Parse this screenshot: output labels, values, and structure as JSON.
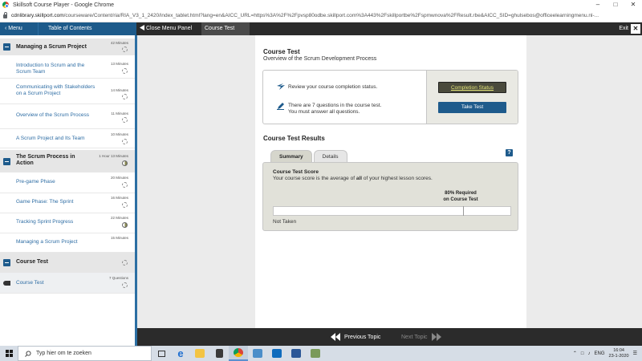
{
  "browser": {
    "window_title": "Skillsoft Course Player - Google Chrome",
    "url_prefix": "cdnlibrary.skillport.com",
    "url_rest": "/courseware/Content/ria/RIA_V3_1_2420/index_tablet.html?lang=en&AICC_URL=https%3A%2F%2Fpvsp80odbe.skillport.com%3A443%2Fskillportbe%2Fspmwnova%2FResult.rbe&AICC_SID=ghulsebos@officeelearningmenu.nl-..."
  },
  "topbar": {
    "menu_label": "Menu",
    "toc_label": "Table of Contents",
    "close_panel_label": "Close Menu Panel",
    "course_tab_label": "Course Test",
    "exit_label": "Exit"
  },
  "sidebar": {
    "modules": [
      {
        "title": "Managing a Scrum Project",
        "duration": "42 Minutes",
        "lessons": [
          {
            "title": "Introduction to Scrum and the Scrum Team",
            "duration": "13 Minutes"
          },
          {
            "title": "Communicating with Stakeholders on a Scrum Project",
            "duration": "14 Minutes"
          },
          {
            "title": "Overview of the Scrum Process",
            "duration": "11 Minutes"
          },
          {
            "title": "A Scrum Project and Its Team",
            "duration": "10 Minutes"
          }
        ]
      },
      {
        "title": "The Scrum Process in Action",
        "duration": "1 Hour 13 Minutes",
        "lessons": [
          {
            "title": "Pre-game Phase",
            "duration": "20 Minutes"
          },
          {
            "title": "Game Phase: The Sprint",
            "duration": "16 Minutes"
          },
          {
            "title": "Tracking Sprint Progress",
            "duration": "22 Minutes"
          },
          {
            "title": "Managing a Scrum Project",
            "duration": "15 Minutes"
          }
        ]
      },
      {
        "title": "Course Test",
        "duration": "",
        "lessons": [
          {
            "title": "Course Test",
            "duration": "7 Questions"
          }
        ]
      }
    ]
  },
  "main": {
    "title": "Course Test",
    "subtitle": "Overview of the Scrum Development Process",
    "status_row_text": "Review your course completion status.",
    "questions_line1": "There are 7 questions in the course test.",
    "questions_line2": "You must answer all questions.",
    "completion_status_button": "Completion Status",
    "take_test_button": "Take Test",
    "results_title": "Course Test Results",
    "tabs": [
      "Summary",
      "Details"
    ],
    "help_label": "?",
    "score_title": "Course Test Score",
    "score_desc_pre": "Your course score is the average of ",
    "score_desc_bold": "all",
    "score_desc_post": " of your highest lesson scores.",
    "required_line1": "80% Required",
    "required_line2": "on Course Test",
    "required_percent": 80,
    "score_status": "Not Taken"
  },
  "bottomnav": {
    "prev_label": "Previous Topic",
    "next_label": "Next Topic"
  },
  "taskbar": {
    "search_placeholder": "Typ hier om te zoeken",
    "language": "ENG",
    "time": "16:04",
    "date": "23-1-2020"
  },
  "colors": {
    "accent_blue": "#1e5b8c",
    "dark_bar": "#2b2b2b",
    "completion_button_text": "#e6e87a"
  }
}
